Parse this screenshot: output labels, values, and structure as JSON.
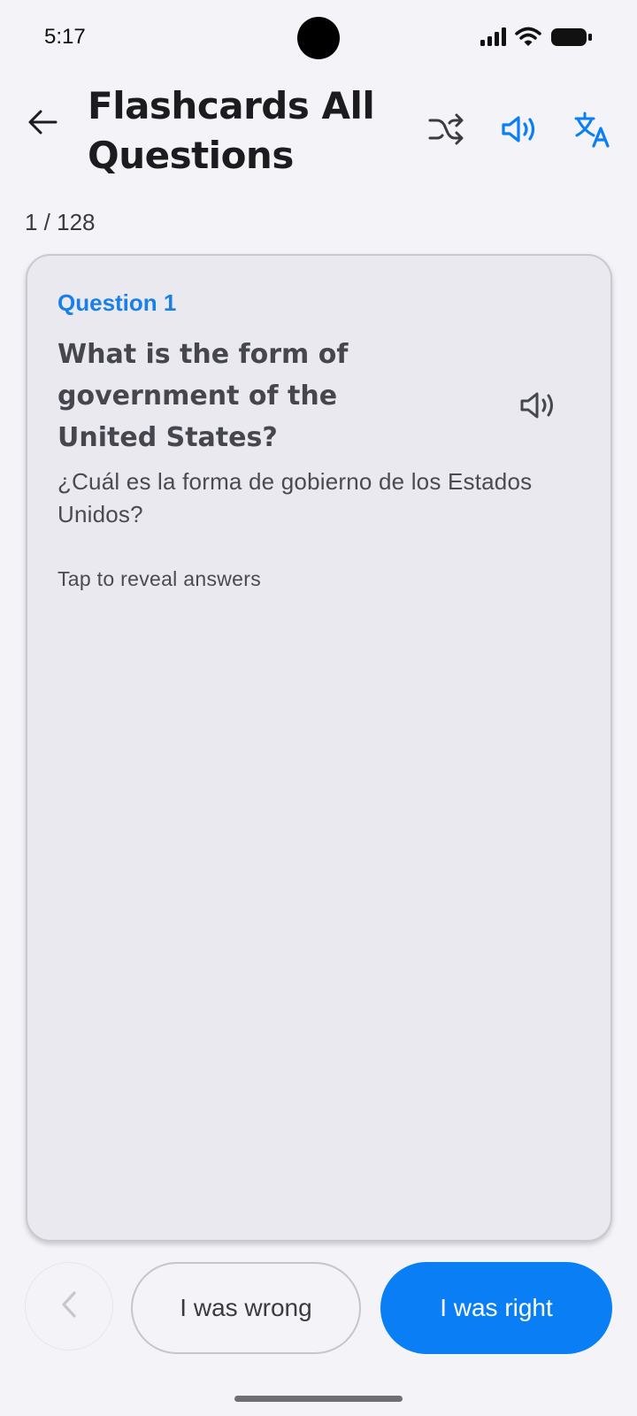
{
  "status_bar": {
    "time": "5:17",
    "icons": [
      "signal-icon",
      "wifi-icon",
      "battery-icon"
    ]
  },
  "header": {
    "title": "Flashcards All Questions",
    "icons": [
      "back-arrow-icon",
      "shuffle-icon",
      "speaker-icon",
      "translate-icon"
    ]
  },
  "progress": {
    "counter": "1 / 128",
    "current": 1,
    "total": 128
  },
  "card": {
    "label": "Question 1",
    "question": "What is the form of government of the United States?",
    "translation": "¿Cuál es la forma de gobierno de los Estados Unidos?",
    "hint": "Tap to reveal answers",
    "icon": "speaker-icon"
  },
  "actions": {
    "wrong_label": "I was wrong",
    "right_label": "I was right",
    "prev_icon": "chevron-left-icon"
  },
  "colors": {
    "accent": "#0a7ff5",
    "background": "#f3f3f8",
    "card": "#e9e9ef",
    "title": "#1c1c1e"
  }
}
